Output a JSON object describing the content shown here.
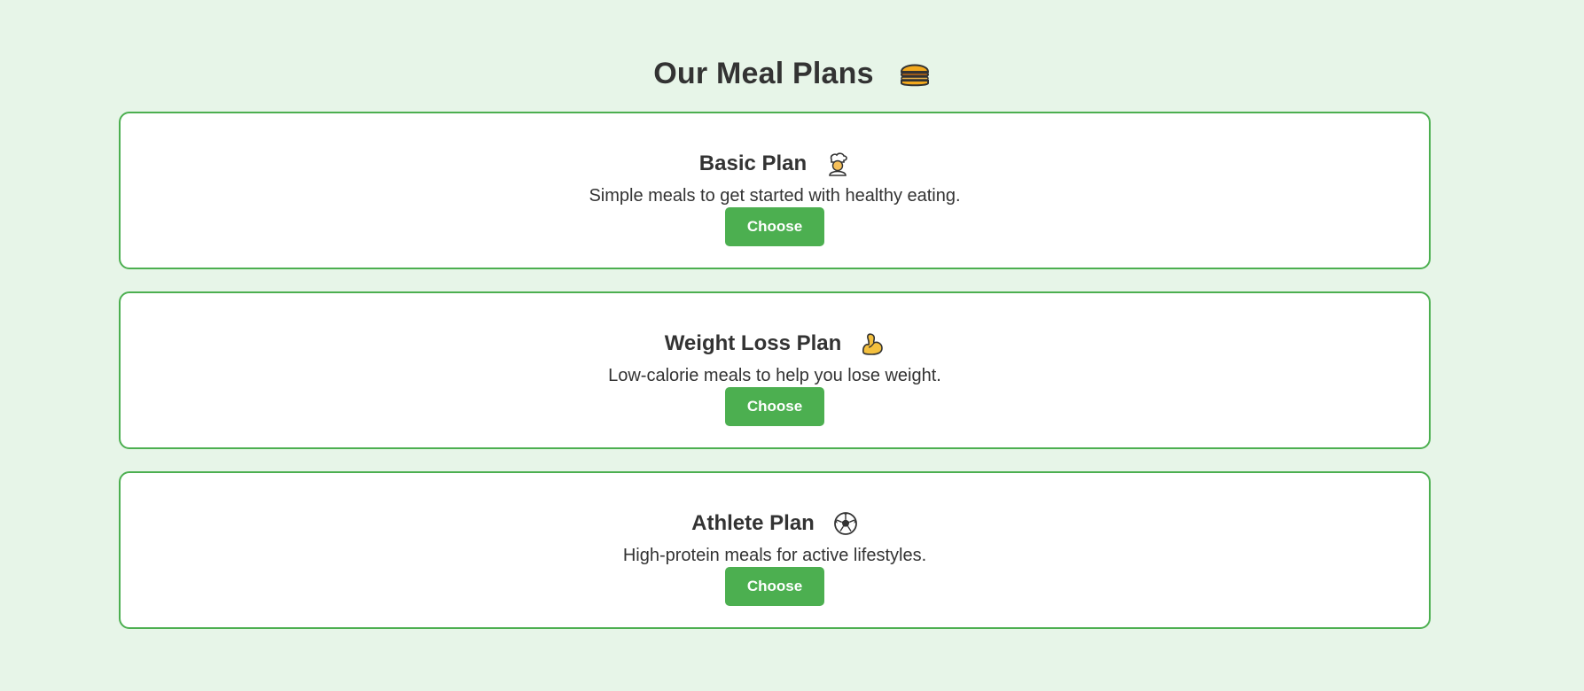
{
  "page": {
    "title": "Our Meal Plans",
    "title_icon": "burger-icon"
  },
  "plans": [
    {
      "title": "Basic Plan",
      "icon": "chef-icon",
      "description": "Simple meals to get started with healthy eating.",
      "button_label": "Choose"
    },
    {
      "title": "Weight Loss Plan",
      "icon": "flexed-bicep-icon",
      "description": "Low-calorie meals to help you lose weight.",
      "button_label": "Choose"
    },
    {
      "title": "Athlete Plan",
      "icon": "soccer-ball-icon",
      "description": "High-protein meals for active lifestyles.",
      "button_label": "Choose"
    }
  ],
  "colors": {
    "background": "#e7f5e8",
    "accent": "#4caf50",
    "card_background": "#ffffff",
    "text": "#333333"
  }
}
